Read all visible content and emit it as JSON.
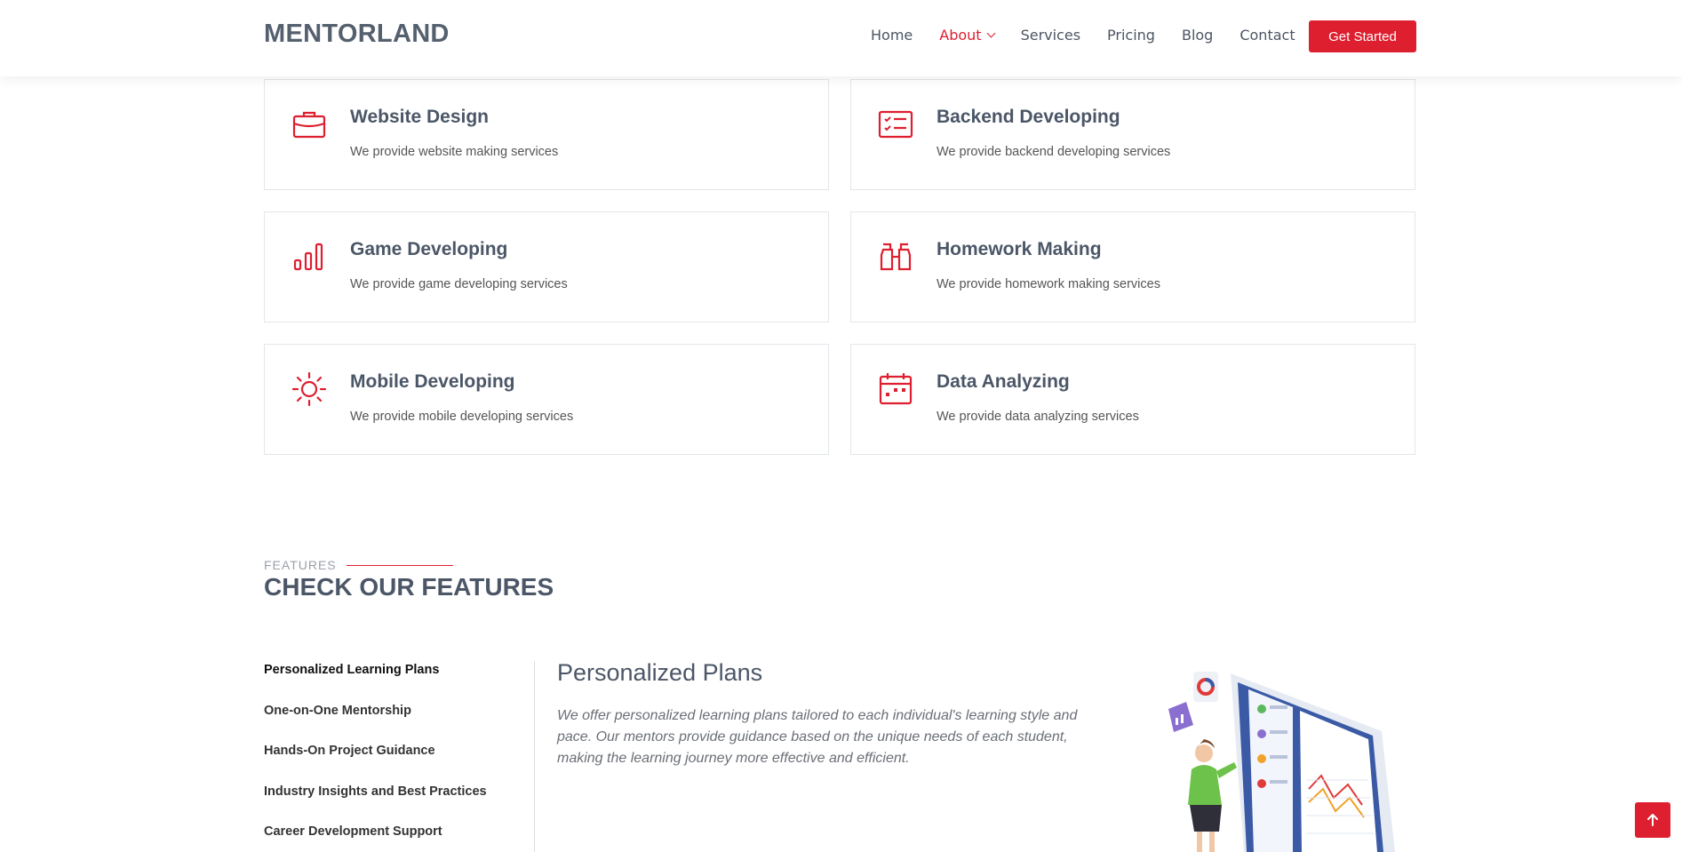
{
  "header": {
    "logo": "MENTORLAND",
    "nav": [
      {
        "label": "Home"
      },
      {
        "label": "About",
        "active": true
      },
      {
        "label": "Services"
      },
      {
        "label": "Pricing"
      },
      {
        "label": "Blog"
      },
      {
        "label": "Contact"
      }
    ],
    "cta_label": "Get Started"
  },
  "services": [
    {
      "title": "Website Design",
      "desc": "We provide website making services",
      "icon": "briefcase-icon"
    },
    {
      "title": "Backend Developing",
      "desc": "We provide backend developing services",
      "icon": "checklist-icon"
    },
    {
      "title": "Game Developing",
      "desc": "We provide game developing services",
      "icon": "bar-chart-icon"
    },
    {
      "title": "Homework Making",
      "desc": "We provide homework making services",
      "icon": "binoculars-icon"
    },
    {
      "title": "Mobile Developing",
      "desc": "We provide mobile developing services",
      "icon": "sun-icon"
    },
    {
      "title": "Data Analyzing",
      "desc": "We provide data analyzing services",
      "icon": "calendar-icon"
    }
  ],
  "features": {
    "label": "FEATURES",
    "title": "CHECK OUR FEATURES",
    "tabs": [
      {
        "label": "Personalized Learning Plans",
        "active": true
      },
      {
        "label": "One-on-One Mentorship"
      },
      {
        "label": "Hands-On Project Guidance"
      },
      {
        "label": "Industry Insights and Best Practices"
      },
      {
        "label": "Career Development Support"
      }
    ],
    "panel": {
      "title": "Personalized Plans",
      "text": "We offer personalized learning plans tailored to each individual's learning style and pace. Our mentors provide guidance based on the unique needs of each student, making the learning journey more effective and efficient."
    }
  },
  "colors": {
    "accent": "#dd1f2f",
    "heading": "#4b5667"
  }
}
